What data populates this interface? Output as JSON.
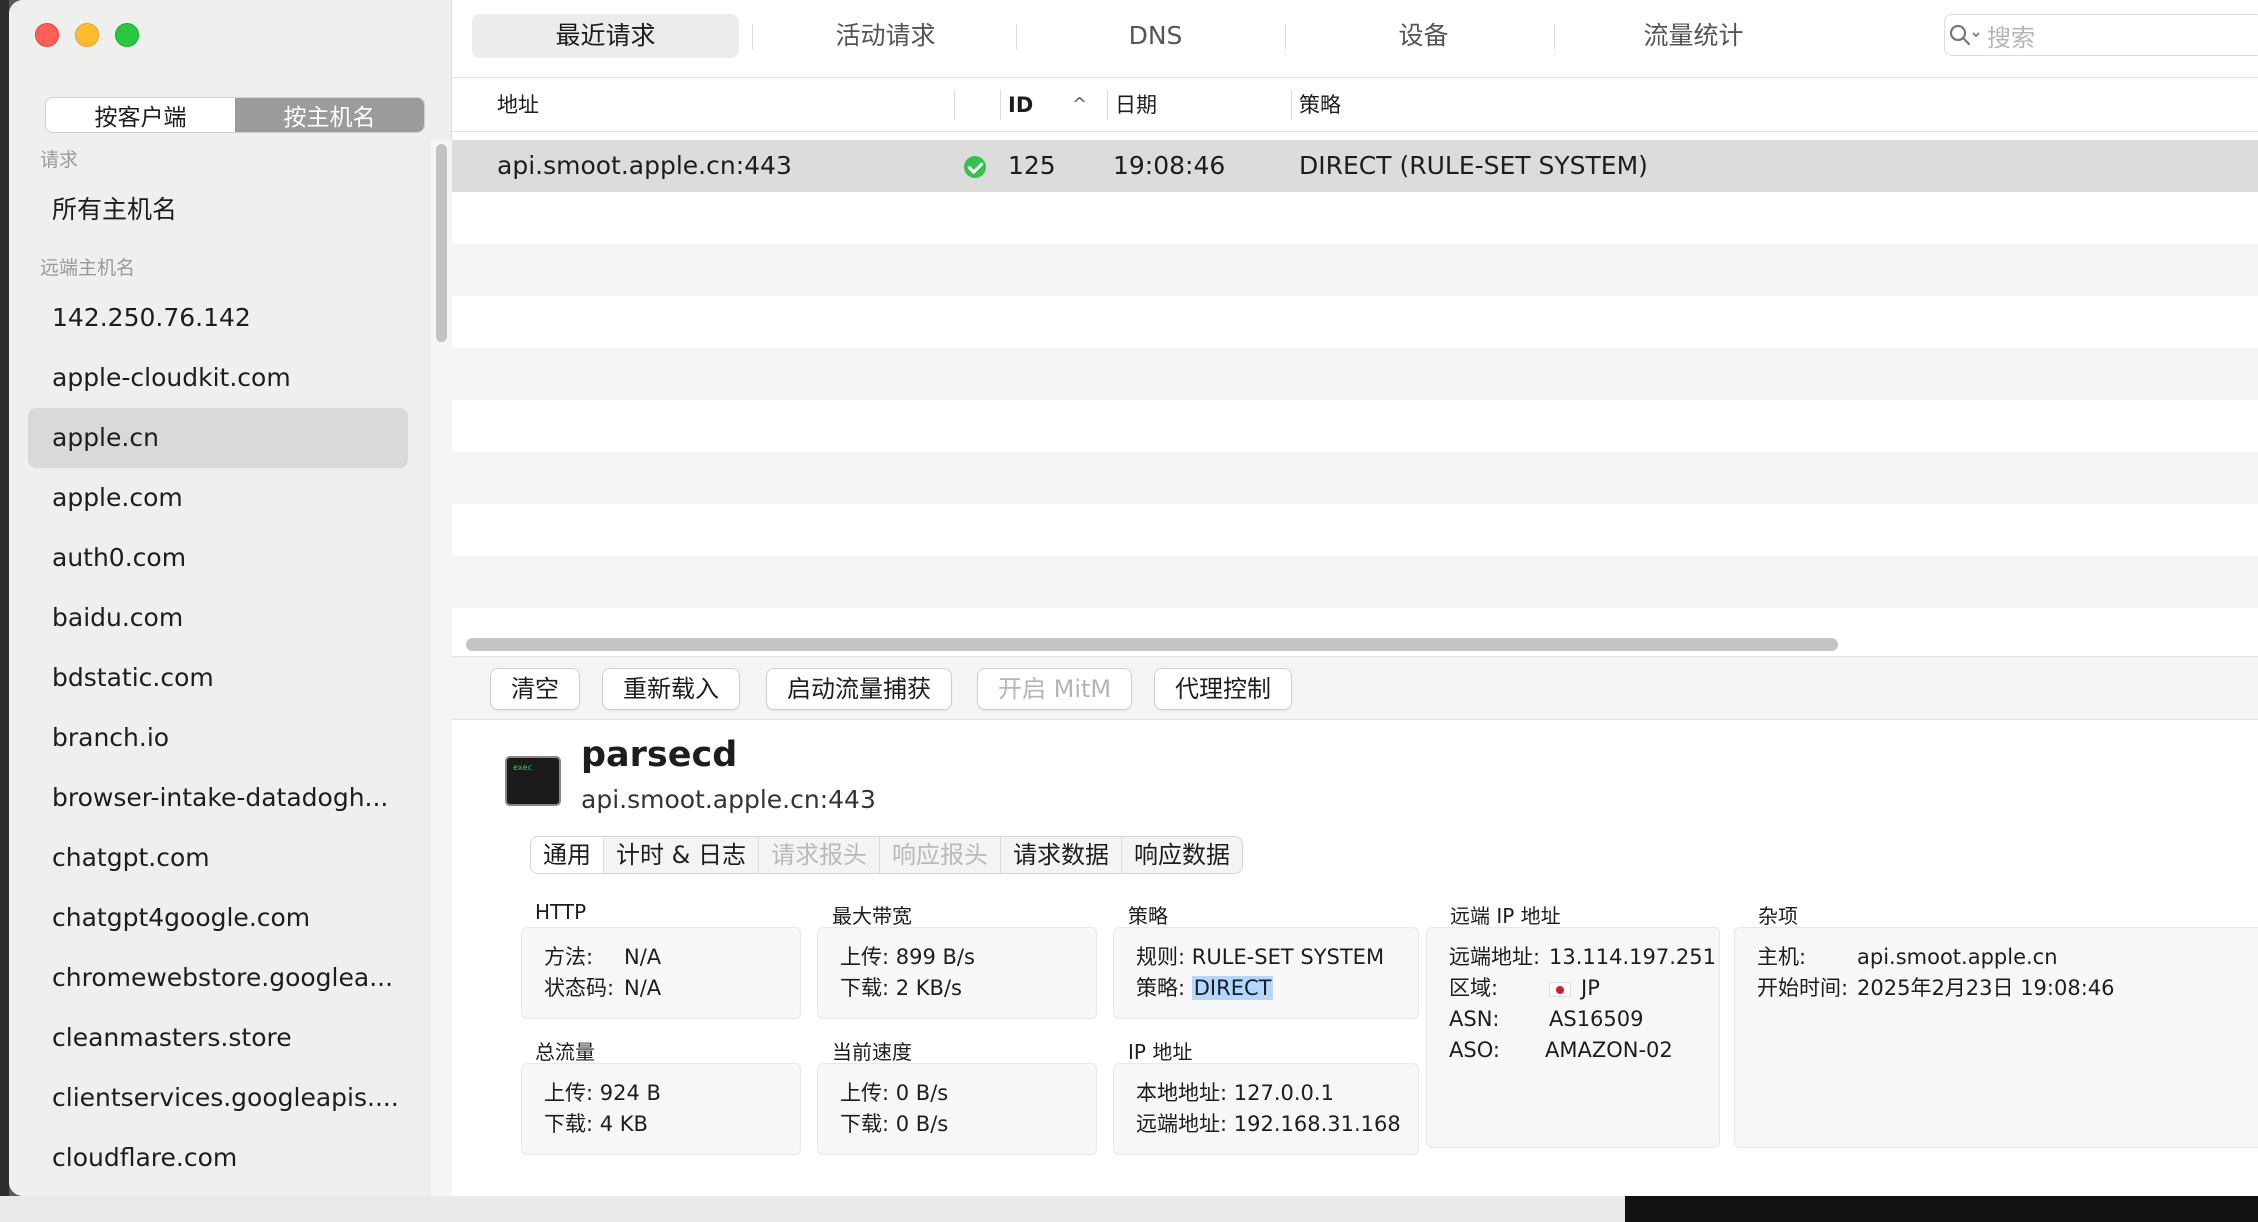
{
  "sidebar": {
    "segments": [
      {
        "label": "按客户端",
        "active": false
      },
      {
        "label": "按主机名",
        "active": true
      }
    ],
    "section_requests": "请求",
    "all_hosts": "所有主机名",
    "section_remote": "远端主机名",
    "hosts": [
      "142.250.76.142",
      "apple-cloudkit.com",
      "apple.cn",
      "apple.com",
      "auth0.com",
      "baidu.com",
      "bdstatic.com",
      "branch.io",
      "browser-intake-datadogh...",
      "chatgpt.com",
      "chatgpt4google.com",
      "chromewebstore.googlea...",
      "cleanmasters.store",
      "clientservices.googleapis....",
      "cloudflare.com"
    ],
    "selected_host": "apple.cn"
  },
  "tabs": [
    "最近请求",
    "活动请求",
    "DNS",
    "设备",
    "流量统计"
  ],
  "active_tab": "最近请求",
  "search": {
    "placeholder": "搜索"
  },
  "table": {
    "headers": {
      "address": "地址",
      "id": "ID",
      "date": "日期",
      "policy": "策略"
    },
    "rows": [
      {
        "address": "api.smoot.apple.cn:443",
        "status": "success",
        "id": "125",
        "date": "19:08:46",
        "policy": "DIRECT (RULE-SET SYSTEM)"
      }
    ]
  },
  "toolbar": {
    "clear": "清空",
    "reload": "重新载入",
    "capture": "启动流量捕获",
    "mitm": "开启 MitM",
    "proxy": "代理控制"
  },
  "detail": {
    "icon_text": "exec",
    "process": "parsecd",
    "host": "api.smoot.apple.cn:443",
    "subtabs": [
      {
        "label": "通用",
        "state": "active"
      },
      {
        "label": "计时 & 日志",
        "state": "normal"
      },
      {
        "label": "请求报头",
        "state": "disabled"
      },
      {
        "label": "响应报头",
        "state": "disabled"
      },
      {
        "label": "请求数据",
        "state": "normal"
      },
      {
        "label": "响应数据",
        "state": "normal"
      }
    ],
    "http": {
      "title": "HTTP",
      "method_k": "方法:",
      "method_v": "N/A",
      "status_k": "状态码:",
      "status_v": "N/A"
    },
    "bandwidth": {
      "title": "最大带宽",
      "up": "上传: 899 B/s",
      "down": "下载: 2 KB/s"
    },
    "policy": {
      "title": "策略",
      "rule": "规则: RULE-SET SYSTEM",
      "policy_k": "策略:",
      "policy_v": "DIRECT"
    },
    "remote_ip": {
      "title": "远端 IP 地址",
      "addr_k": "远端地址:",
      "addr_v": "13.114.197.251",
      "region_k": "区域:",
      "region_v": "JP",
      "asn_k": "ASN:",
      "asn_v": "AS16509",
      "aso_k": "ASO:",
      "aso_v": "AMAZON-02"
    },
    "misc": {
      "title": "杂项",
      "host_k": "主机:",
      "host_v": "api.smoot.apple.cn",
      "start_k": "开始时间:",
      "start_v": "2025年2月23日 19:08:46"
    },
    "total": {
      "title": "总流量",
      "up": "上传: 924 B",
      "down": "下载: 4 KB"
    },
    "speed": {
      "title": "当前速度",
      "up": "上传: 0 B/s",
      "down": "下载: 0 B/s"
    },
    "ip": {
      "title": "IP 地址",
      "local": "本地地址: 127.0.0.1",
      "remote": "远端地址: 192.168.31.168"
    }
  }
}
